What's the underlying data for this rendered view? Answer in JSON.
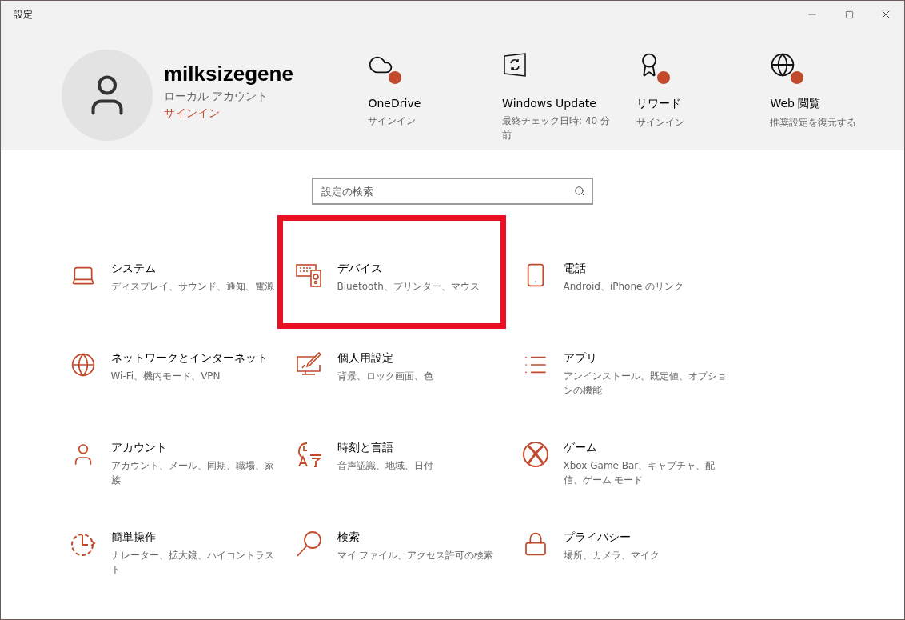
{
  "window": {
    "title": "設定"
  },
  "account": {
    "name": "milksizegene",
    "type": "ローカル アカウント",
    "action": "サインイン"
  },
  "header_items": [
    {
      "kind": "cloud",
      "title": "OneDrive",
      "subtitle": "サインイン",
      "alert": true
    },
    {
      "kind": "update",
      "title": "Windows Update",
      "subtitle": "最終チェック日時: 40 分前",
      "alert": false
    },
    {
      "kind": "reward",
      "title": "リワード",
      "subtitle": "サインイン",
      "alert": true
    },
    {
      "kind": "web",
      "title": "Web 閲覧",
      "subtitle": "推奨設定を復元する",
      "alert": true
    }
  ],
  "search": {
    "placeholder": "設定の検索"
  },
  "categories": [
    {
      "kind": "system",
      "title": "システム",
      "description": "ディスプレイ、サウンド、通知、電源",
      "highlighted": false
    },
    {
      "kind": "devices",
      "title": "デバイス",
      "description": "Bluetooth、プリンター、マウス",
      "highlighted": true
    },
    {
      "kind": "phone",
      "title": "電話",
      "description": "Android、iPhone のリンク",
      "highlighted": false
    },
    {
      "kind": "network",
      "title": "ネットワークとインターネット",
      "description": "Wi-Fi、機内モード、VPN",
      "highlighted": false
    },
    {
      "kind": "personalization",
      "title": "個人用設定",
      "description": "背景、ロック画面、色",
      "highlighted": false
    },
    {
      "kind": "apps",
      "title": "アプリ",
      "description": "アンインストール、既定値、オプションの機能",
      "highlighted": false
    },
    {
      "kind": "accounts",
      "title": "アカウント",
      "description": "アカウント、メール、同期、職場、家族",
      "highlighted": false
    },
    {
      "kind": "time",
      "title": "時刻と言語",
      "description": "音声認識、地域、日付",
      "highlighted": false
    },
    {
      "kind": "gaming",
      "title": "ゲーム",
      "description": "Xbox Game Bar、キャプチャ、配信、ゲーム モード",
      "highlighted": false
    },
    {
      "kind": "ease",
      "title": "簡単操作",
      "description": "ナレーター、拡大鏡、ハイコントラスト",
      "highlighted": false
    },
    {
      "kind": "search",
      "title": "検索",
      "description": "マイ ファイル、アクセス許可の検索",
      "highlighted": false
    },
    {
      "kind": "privacy",
      "title": "プライバシー",
      "description": "場所、カメラ、マイク",
      "highlighted": false
    }
  ]
}
